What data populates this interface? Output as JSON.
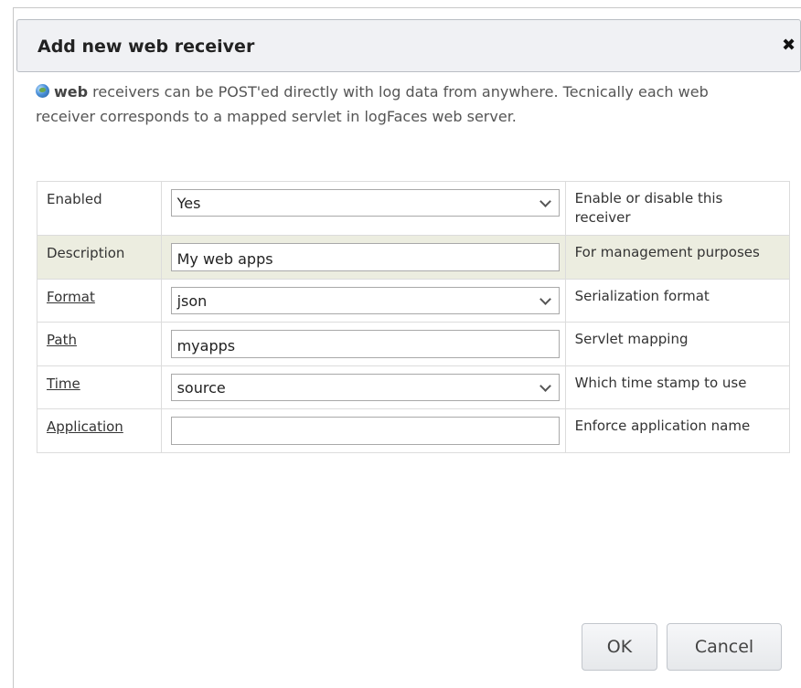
{
  "dialog": {
    "title": "Add new web receiver",
    "close_glyph": "✖",
    "icons": {
      "close": "close-icon",
      "globe": "globe-icon",
      "dropdown": "chevron-down-icon"
    }
  },
  "intro": {
    "strong": "web",
    "rest": " receivers can be POST'ed directly with log data from anywhere. Tecnically each web receiver corresponds to a mapped servlet in logFaces web server."
  },
  "form": {
    "rows": [
      {
        "label": "Enabled",
        "type": "select",
        "value": "Yes",
        "help": "Enable or disable this receiver",
        "link": false
      },
      {
        "label": "Description",
        "type": "text",
        "value": "My web apps",
        "help": "For management purposes",
        "link": false
      },
      {
        "label": "Format",
        "type": "select",
        "value": "json",
        "help": "Serialization format",
        "link": true
      },
      {
        "label": "Path",
        "type": "text",
        "value": "myapps",
        "help": "Servlet mapping",
        "link": true
      },
      {
        "label": "Time",
        "type": "select",
        "value": "source",
        "help": "Which time stamp to use",
        "link": true
      },
      {
        "label": "Application",
        "type": "text",
        "value": "",
        "help": "Enforce application name",
        "link": true
      }
    ]
  },
  "buttons": {
    "ok": "OK",
    "cancel": "Cancel"
  },
  "colors": {
    "title_bar_bg": "#f0f1f4",
    "highlight_row_bg": "#ecede0",
    "border": "#dcdcdc"
  }
}
